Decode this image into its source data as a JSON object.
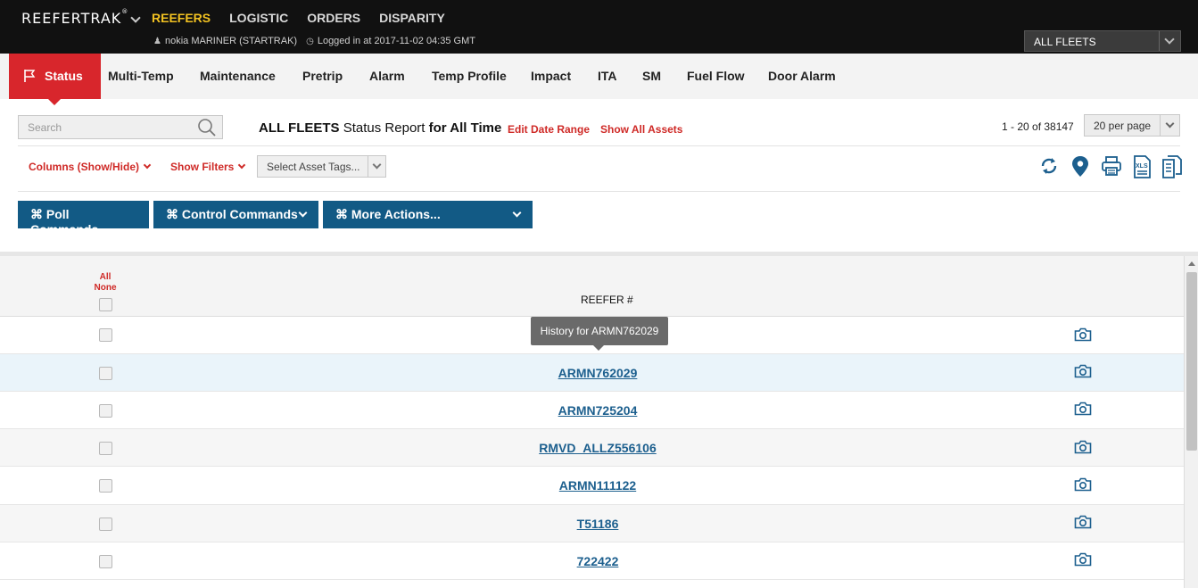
{
  "brand": {
    "name": "REEFERTRAK",
    "mark": "®"
  },
  "topnav": [
    {
      "label": "REEFERS",
      "active": true
    },
    {
      "label": "LOGISTIC",
      "active": false
    },
    {
      "label": "ORDERS",
      "active": false
    },
    {
      "label": "DISPARITY",
      "active": false
    }
  ],
  "user": {
    "name": "nokia MARINER (STARTRAK)",
    "login": "Logged in at 2017-11-02 04:35 GMT"
  },
  "fleet_select": {
    "value": "ALL FLEETS"
  },
  "tabs": [
    {
      "label": "Status",
      "active": true
    },
    {
      "label": "Multi-Temp"
    },
    {
      "label": "Maintenance"
    },
    {
      "label": "Pretrip"
    },
    {
      "label": "Alarm"
    },
    {
      "label": "Temp Profile"
    },
    {
      "label": "Impact"
    },
    {
      "label": "ITA"
    },
    {
      "label": "SM"
    },
    {
      "label": "Fuel Flow"
    },
    {
      "label": "Door Alarm"
    }
  ],
  "search": {
    "placeholder": "Search"
  },
  "report": {
    "fleet": "ALL FLEETS",
    "name": "Status Report",
    "range": "for All Time",
    "edit_range": "Edit Date Range",
    "show_all": "Show All Assets"
  },
  "pagination": {
    "count": "1 - 20 of 38147",
    "per_page": "20 per page"
  },
  "filters": {
    "columns": "Columns (Show/Hide)",
    "show_filters": "Show Filters",
    "asset_tags_placeholder": "Select Asset Tags..."
  },
  "toolbar_icons": [
    "refresh-icon",
    "map-pin-icon",
    "print-icon",
    "xls-export-icon",
    "copy-icon"
  ],
  "actions": {
    "poll": "⌘ Poll Commands",
    "control": "⌘ Control Commands",
    "more": "⌘ More Actions..."
  },
  "table": {
    "select_all": "All",
    "select_none": "None",
    "column_reefer": "REEFER #",
    "rows": [
      {
        "reefer": ""
      },
      {
        "reefer": "ARMN762029"
      },
      {
        "reefer": "ARMN725204"
      },
      {
        "reefer": "RMVD_ALLZ556106"
      },
      {
        "reefer": "ARMN111122"
      },
      {
        "reefer": "T51186"
      },
      {
        "reefer": "722422"
      }
    ]
  },
  "tooltip": {
    "text": "History for ARMN762029"
  },
  "colors": {
    "accent_red": "#d8262c",
    "link_blue": "#1c5f8e",
    "button_blue": "#125a85",
    "nav_active": "#f2c221"
  }
}
